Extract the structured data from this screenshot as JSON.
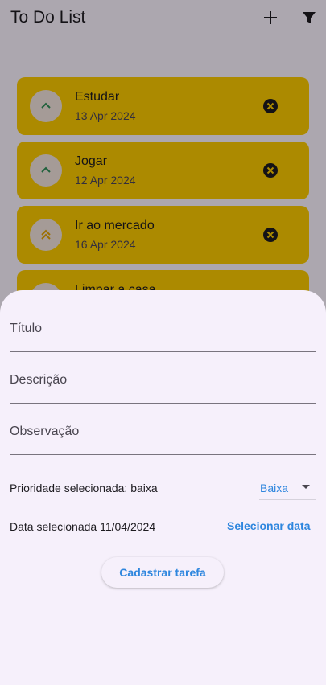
{
  "app": {
    "title": "To Do List"
  },
  "tasks": [
    {
      "name": "Estudar",
      "date": "13 Apr 2024",
      "priority_icon": "chevron-up-icon"
    },
    {
      "name": "Jogar",
      "date": "12 Apr 2024",
      "priority_icon": "chevron-up-icon"
    },
    {
      "name": "Ir ao mercado",
      "date": "16 Apr 2024",
      "priority_icon": "double-chevron-up-icon"
    },
    {
      "name": "Limpar a casa",
      "date": "",
      "priority_icon": "chevron-up-icon"
    }
  ],
  "form": {
    "title_label": "Título",
    "description_label": "Descrição",
    "observation_label": "Observação",
    "priority_text": "Prioridade selecionada: baixa",
    "priority_value": "Baixa",
    "date_text": "Data selecionada 11/04/2024",
    "select_date_label": "Selecionar data",
    "submit_label": "Cadastrar tarefa"
  },
  "colors": {
    "card": "#f7c600",
    "accent": "#2e86de",
    "sheet": "#f6f0fb"
  }
}
